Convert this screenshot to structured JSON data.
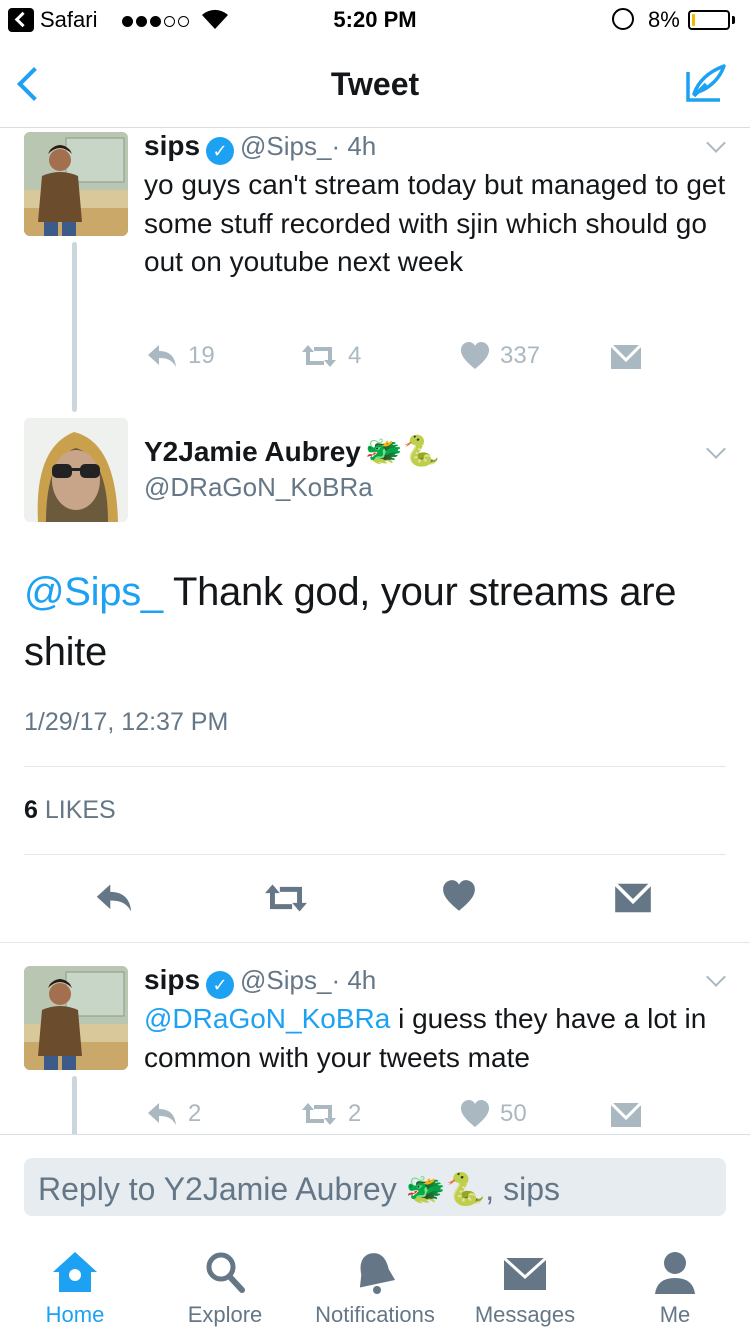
{
  "status_bar": {
    "app": "Safari",
    "time": "5:20 PM",
    "battery": "8%",
    "battery_level": 0.08
  },
  "nav": {
    "title": "Tweet"
  },
  "tweet1": {
    "name": "sips",
    "handle": "@Sips_",
    "time": "· 4h",
    "text": "yo guys can't stream today but managed to get some stuff recorded with sjin which should go out on youtube next week",
    "replies": "19",
    "retweets": "4",
    "likes": "337"
  },
  "main_tweet": {
    "name": "Y2Jamie Aubrey",
    "emoji": "🐲🐍",
    "handle": "@DRaGoN_KoBRa",
    "mention": "@Sips_",
    "text": " Thank god, your streams are shite",
    "timestamp": "1/29/17, 12:37 PM",
    "likes_count": "6",
    "likes_label": " LIKES"
  },
  "tweet3": {
    "name": "sips",
    "handle": "@Sips_",
    "time": "· 4h",
    "mention": "@DRaGoN_KoBRa",
    "text": " i guess they have a lot in common with your tweets mate",
    "replies": "2",
    "retweets": "2",
    "likes": "50"
  },
  "reply_bar": {
    "placeholder": "Reply to Y2Jamie Aubrey 🐲🐍, sips"
  },
  "tabs": [
    {
      "label": "Home",
      "icon": "home-icon",
      "active": true
    },
    {
      "label": "Explore",
      "icon": "search-icon"
    },
    {
      "label": "Notifications",
      "icon": "bell-icon"
    },
    {
      "label": "Messages",
      "icon": "envelope-icon"
    },
    {
      "label": "Me",
      "icon": "person-icon"
    }
  ],
  "colors": {
    "accent": "#1da1f2",
    "verified": "#1da1f2",
    "muted": "#aab8c2"
  }
}
